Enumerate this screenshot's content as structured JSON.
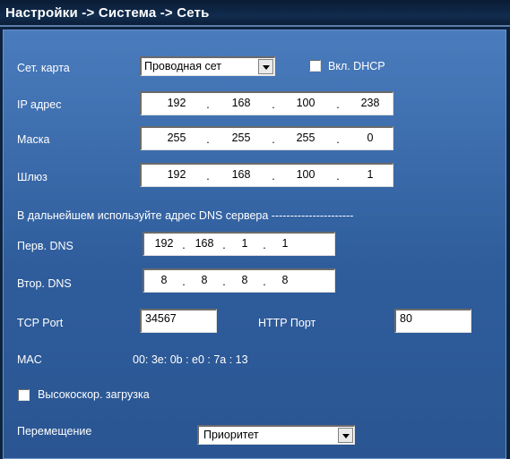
{
  "title": "Настройки -> Система -> Сеть",
  "net_card": {
    "label": "Сет. карта",
    "value": "Проводная сет"
  },
  "dhcp": {
    "label": "Вкл. DHCP",
    "checked": false
  },
  "ip": {
    "label": "IP адрес",
    "octets": [
      "192",
      "168",
      "100",
      "238"
    ]
  },
  "mask": {
    "label": "Маска",
    "octets": [
      "255",
      "255",
      "255",
      "0"
    ]
  },
  "gateway": {
    "label": "Шлюз",
    "octets": [
      "192",
      "168",
      "100",
      "1"
    ]
  },
  "dns_note": "В дальнейшем используйте адрес DNS сервера ----------------------",
  "dns1": {
    "label": "Перв. DNS",
    "octets": [
      "192",
      "168",
      "1",
      "1"
    ]
  },
  "dns2": {
    "label": "Втор. DNS",
    "octets": [
      "8",
      "8",
      "8",
      "8"
    ]
  },
  "tcp_port": {
    "label": "TCP Port",
    "value": "34567"
  },
  "http_port": {
    "label": "HTTP Порт",
    "value": "80"
  },
  "mac": {
    "label": "MAC",
    "value": "00: 3e: 0b : e0 : 7a : 13"
  },
  "hs_download": {
    "label": "Высокоскор. загрузка",
    "checked": false
  },
  "transfer": {
    "label": "Перемещение",
    "value": "Приоритет"
  },
  "dot": "."
}
